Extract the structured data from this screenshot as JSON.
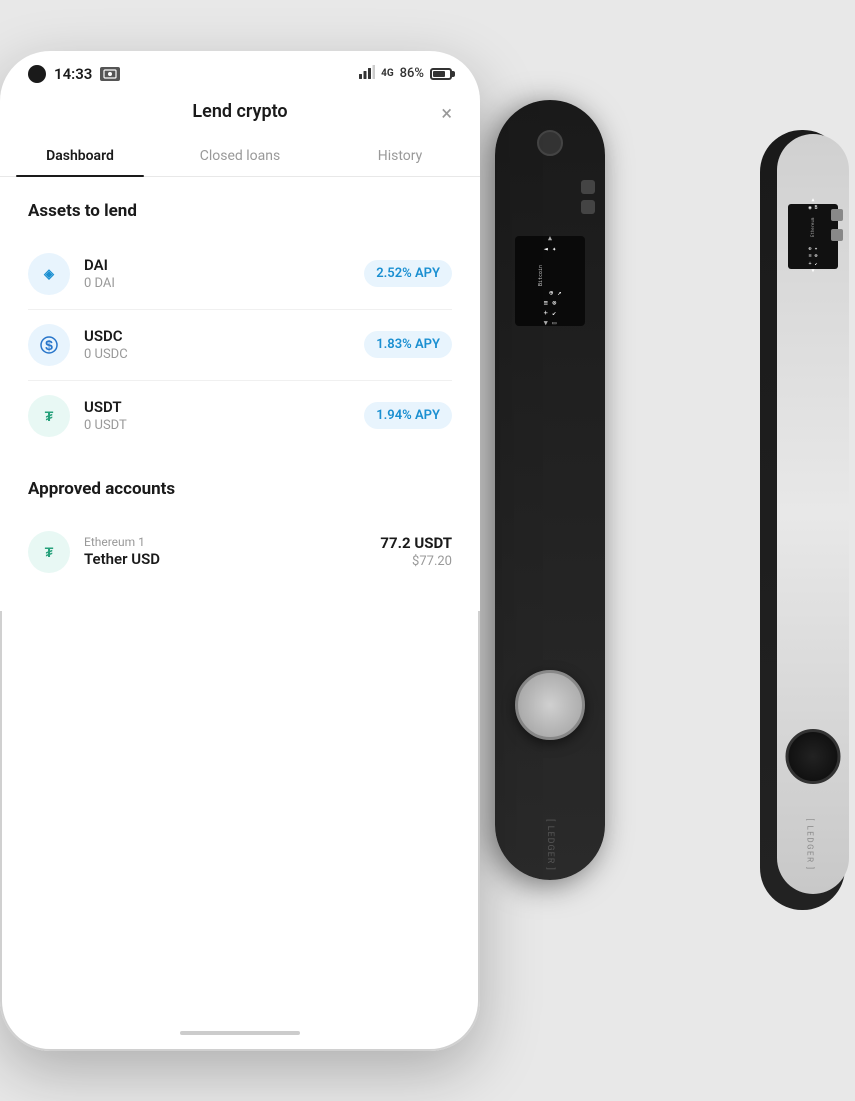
{
  "status": {
    "time": "14:33",
    "battery": "86%"
  },
  "app": {
    "title": "Lend crypto",
    "close_label": "×"
  },
  "tabs": [
    {
      "label": "Dashboard",
      "active": true,
      "id": "dashboard"
    },
    {
      "label": "Closed loans",
      "active": false,
      "id": "closed-loans"
    },
    {
      "label": "History",
      "active": false,
      "id": "history"
    }
  ],
  "assets_section": {
    "title": "Assets to lend",
    "items": [
      {
        "name": "DAI",
        "balance": "0 DAI",
        "apy": "2.52% APY",
        "icon": "dai"
      },
      {
        "name": "USDC",
        "balance": "0 USDC",
        "apy": "1.83% APY",
        "icon": "usdc"
      },
      {
        "name": "USDT",
        "balance": "0 USDT",
        "apy": "1.94% APY",
        "icon": "usdt"
      }
    ]
  },
  "approved_section": {
    "title": "Approved accounts",
    "items": [
      {
        "network": "Ethereum 1",
        "name": "Tether USD",
        "amount": "77.2 USDT",
        "usd": "$77.20",
        "icon": "usdt"
      }
    ]
  },
  "ledger": {
    "brand": "LEDGER"
  }
}
